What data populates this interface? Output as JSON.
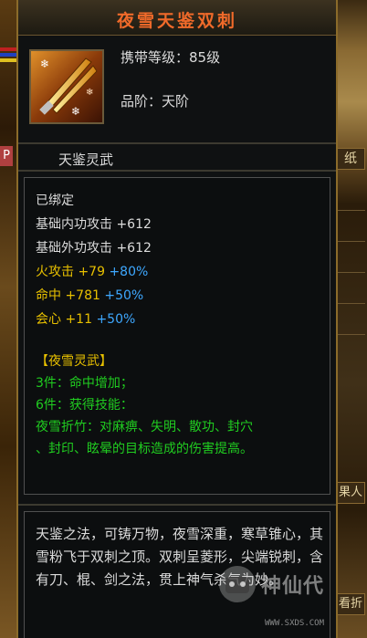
{
  "item": {
    "title": "夜雪天鉴双刺",
    "requirement": "携带等级：85级",
    "grade": "品阶：天阶",
    "category": "天鉴灵武",
    "icon": "twin-dagger-icon"
  },
  "status": {
    "bound": "已绑定"
  },
  "attributes": {
    "base_inner": {
      "label": "基础内功攻击",
      "value": "+612"
    },
    "base_outer": {
      "label": "基础外功攻击",
      "value": "+612"
    },
    "fire": {
      "label": "火攻击",
      "value": "+79",
      "bonus": "+80%"
    },
    "hit": {
      "label": "命中",
      "value": "+781",
      "bonus": "+50%"
    },
    "crit": {
      "label": "会心",
      "value": "+11",
      "bonus": "+50%"
    }
  },
  "set_bonus": {
    "name": "【夜雪灵武】",
    "piece3": "3件：命中增加；",
    "piece6": "6件：获得技能：",
    "skill_line1": "夜雪折竹：对麻痹、失明、散功、封穴",
    "skill_line2": "、封印、眩晕的目标造成的伤害提高。"
  },
  "description": "天鉴之法，可铸万物，夜雪深重，寒草锥心，其雪粉飞于双刺之顶。双刺呈菱形，尖端锐刺，含有刀、棍、剑之法，贯上神气杀气为妙。",
  "side_tabs": {
    "tab1": "P",
    "tab2": "纸",
    "tab3": "果人",
    "tab4": "看折"
  },
  "watermark": {
    "name": "神仙代",
    "url": "WWW.SXDS.COM"
  },
  "colors": {
    "title": "#f06a2a",
    "normal": "#dcdcdc",
    "yellow": "#e8c000",
    "blue": "#3ea8ff",
    "green": "#20cc20",
    "border": "#8b6b2a"
  }
}
